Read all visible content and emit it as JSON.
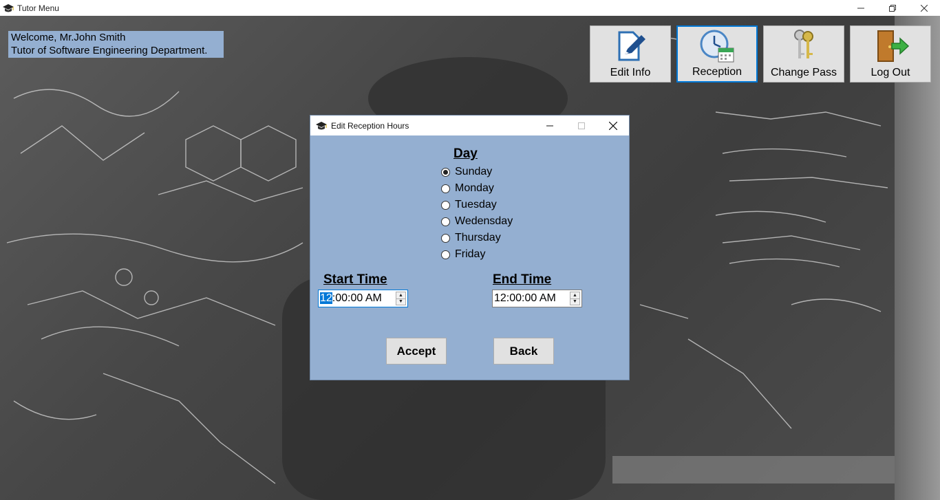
{
  "window": {
    "title": "Tutor Menu",
    "icon": "graduation-cap-icon",
    "controls": [
      "minimize-icon",
      "maximize-icon",
      "close-icon"
    ]
  },
  "welcome": {
    "line1": "Welcome, Mr.John Smith",
    "line2": "Tutor of Software Engineering Department."
  },
  "toolbar": {
    "edit_info": "Edit Info",
    "reception": "Reception",
    "change_pass": "Change Pass",
    "log_out": "Log Out",
    "active": "reception"
  },
  "dialog": {
    "title": "Edit Reception Hours",
    "day_heading": "Day",
    "days": [
      {
        "label": "Sunday",
        "checked": true
      },
      {
        "label": "Monday",
        "checked": false
      },
      {
        "label": "Tuesday",
        "checked": false
      },
      {
        "label": "Wedensday",
        "checked": false
      },
      {
        "label": "Thursday",
        "checked": false
      },
      {
        "label": "Friday",
        "checked": false
      }
    ],
    "start_time_heading": "Start Time",
    "start_time": {
      "selected_part": "12",
      "rest": ":00:00 AM"
    },
    "end_time_heading": "End Time",
    "end_time": "12:00:00 AM",
    "accept": "Accept",
    "back": "Back"
  },
  "colors": {
    "panel": "#94afd1",
    "accent": "#0078d7",
    "button_face": "#e1e1e1"
  }
}
